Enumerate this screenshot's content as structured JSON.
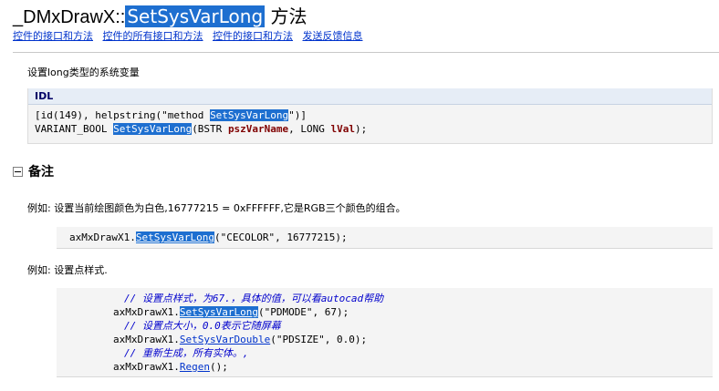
{
  "header": {
    "class_name": "_DMxDrawX::",
    "method_name": "SetSysVarLong",
    "suffix": " 方法"
  },
  "nav": {
    "links": [
      "控件的接口和方法",
      "控件的所有接口和方法",
      "控件的接口和方法",
      "发送反馈信息"
    ]
  },
  "summary": "设置long类型的系统变量",
  "idl": {
    "heading": "IDL",
    "line1_prefix": "[id(149), helpstring(\"method ",
    "line1_highlight": "SetSysVarLong",
    "line1_suffix": "\")]",
    "line2_type": "VARIANT_BOOL ",
    "line2_name": "SetSysVarLong",
    "line2_open": "(BSTR ",
    "param1": "pszVarName",
    "line2_mid": ", LONG ",
    "param2": "lVal",
    "line2_close": ");"
  },
  "remarks": {
    "title": "备注",
    "example1_text": "例如: 设置当前绘图颜色为白色,16777215 = 0xFFFFFF,它是RGB三个颜色的组合。",
    "example1_code": {
      "prefix": "axMxDrawX1.",
      "method": "SetSysVarLong",
      "args": "(\"CECOLOR\", 16777215);"
    },
    "example2_text": "例如: 设置点样式.",
    "example2_code": {
      "comment1": "// 设置点样式，为67.，具体的值，可以看autocad帮助",
      "line1_prefix": "axMxDrawX1.",
      "line1_method": "SetSysVarLong",
      "line1_args": "(\"PDMODE\", 67);",
      "comment2": "// 设置点大小，0.0表示它随屏幕",
      "line2_prefix": "axMxDrawX1.",
      "line2_method": "SetSysVarDouble",
      "line2_args": "(\"PDSIZE\", 0.0);",
      "comment3": "// 重新生成，所有实体。,",
      "line3_prefix": "axMxDrawX1.",
      "line3_method": "Regen",
      "line3_args": "();"
    }
  },
  "colors": {
    "highlight": "#1e6fd0",
    "link": "#0033cc",
    "comment": "#0000cc",
    "param": "#800000",
    "code_bg": "#f4f4f4"
  }
}
